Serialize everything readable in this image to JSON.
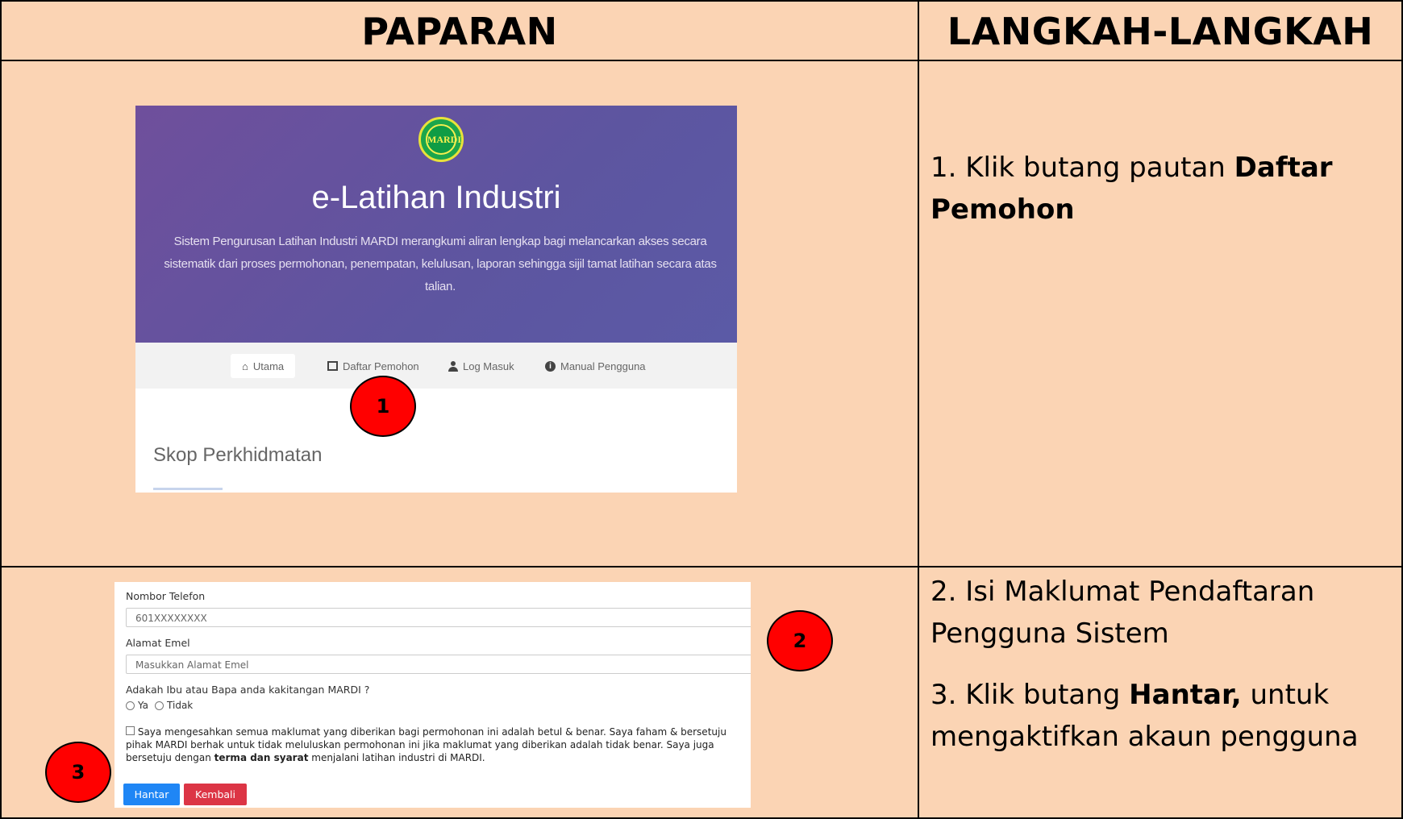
{
  "table": {
    "headers": [
      "PAPARAN",
      "LANGKAH-LANGKAH"
    ]
  },
  "step1": {
    "text_prefix": "1. Klik butang pautan ",
    "text_bold": "Daftar Pemohon"
  },
  "step2": {
    "text": "2. Isi Maklumat Pendaftaran Pengguna Sistem"
  },
  "step3": {
    "text_prefix": "3. Klik butang ",
    "text_bold": "Hantar,",
    "text_suffix": " untuk mengaktifkan akaun pengguna"
  },
  "shot1": {
    "logo_text": "MARDI",
    "title": "e-Latihan Industri",
    "description": "Sistem Pengurusan Latihan Industri MARDI merangkumi aliran lengkap bagi melancarkan akses secara sistematik dari proses permohonan, penempatan, kelulusan, laporan sehingga sijil tamat latihan secara atas talian.",
    "nav": [
      "Utama",
      "Daftar Pemohon",
      "Log Masuk",
      "Manual Pengguna"
    ],
    "section_title": "Skop Perkhidmatan",
    "nav_icons": [
      "home-icon",
      "list-icon",
      "user-icon",
      "info-icon"
    ]
  },
  "shot2": {
    "phone_label": "Nombor Telefon",
    "phone_placeholder": "601XXXXXXXX",
    "email_label": "Alamat Emel",
    "email_placeholder": "Masukkan Alamat Emel",
    "parent_question": "Adakah Ibu atau Bapa anda kakitangan MARDI ?",
    "option_yes": "Ya",
    "option_no": "Tidak",
    "declaration_part1": "Saya mengesahkan semua maklumat yang diberikan bagi permohonan ini adalah betul & benar. Saya faham & bersetuju pihak MARDI berhak untuk tidak meluluskan permohonan ini jika maklumat yang diberikan adalah tidak benar. Saya juga bersetuju dengan ",
    "declaration_bold": "terma dan syarat",
    "declaration_part2": " menjalani latihan industri di MARDI.",
    "submit_label": "Hantar",
    "back_label": "Kembali"
  },
  "markers": [
    "1",
    "2",
    "3"
  ],
  "colors": {
    "table_bg": "#fbd4b4",
    "marker": "#ff0000",
    "hero": "#5d55a0",
    "submit": "#1f86f5",
    "back": "#dc3545"
  }
}
